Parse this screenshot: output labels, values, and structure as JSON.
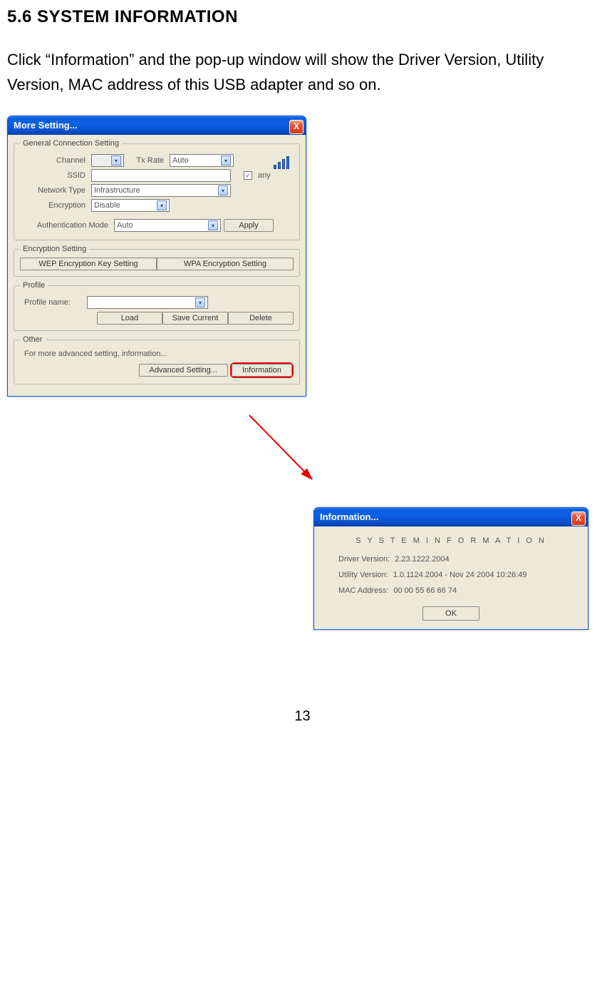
{
  "heading": "5.6 SYSTEM INFORMATION",
  "intro": "Click “Information” and the pop-up window will show the Driver Version, Utility Version, MAC address of this USB adapter and so on.",
  "page_number": "13",
  "more_dialog": {
    "title": "More Setting...",
    "close": "X",
    "sec_general": "General Connection Setting",
    "lbl_channel": "Channel",
    "lbl_txrate": "Tx Rate",
    "val_txrate": "Auto",
    "lbl_ssid": "SSID",
    "chk_any": "any",
    "lbl_nettype": "Network Type",
    "val_nettype": "Infrastructure",
    "lbl_encryption": "Encryption",
    "val_encryption": "Disable",
    "lbl_authmode": "Authentication Mode",
    "val_authmode": "Auto",
    "btn_apply": "Apply",
    "sec_encset": "Encryption Setting",
    "btn_wep": "WEP Encryption Key Setting",
    "btn_wpa": "WPA Encryption Setting",
    "sec_profile": "Profile",
    "lbl_profname": "Profile name:",
    "btn_load": "Load",
    "btn_save": "Save Current",
    "btn_delete": "Delete",
    "sec_other": "Other",
    "txt_other": "For more advanced setting, information...",
    "btn_adv": "Advanced Setting...",
    "btn_info": "Information"
  },
  "info_dialog": {
    "title": "Information...",
    "close": "X",
    "heading": "S Y S T E M   I N F O R M A T I O N",
    "lbl_driver": "Driver Version:",
    "val_driver": "2.23.1222.2004",
    "lbl_utility": "Utility Version:",
    "val_utility": "1.0.1124.2004 - Nov 24 2004 10:26:49",
    "lbl_mac": "MAC Address:",
    "val_mac": "00 00 55 66 66 74",
    "btn_ok": "OK"
  }
}
